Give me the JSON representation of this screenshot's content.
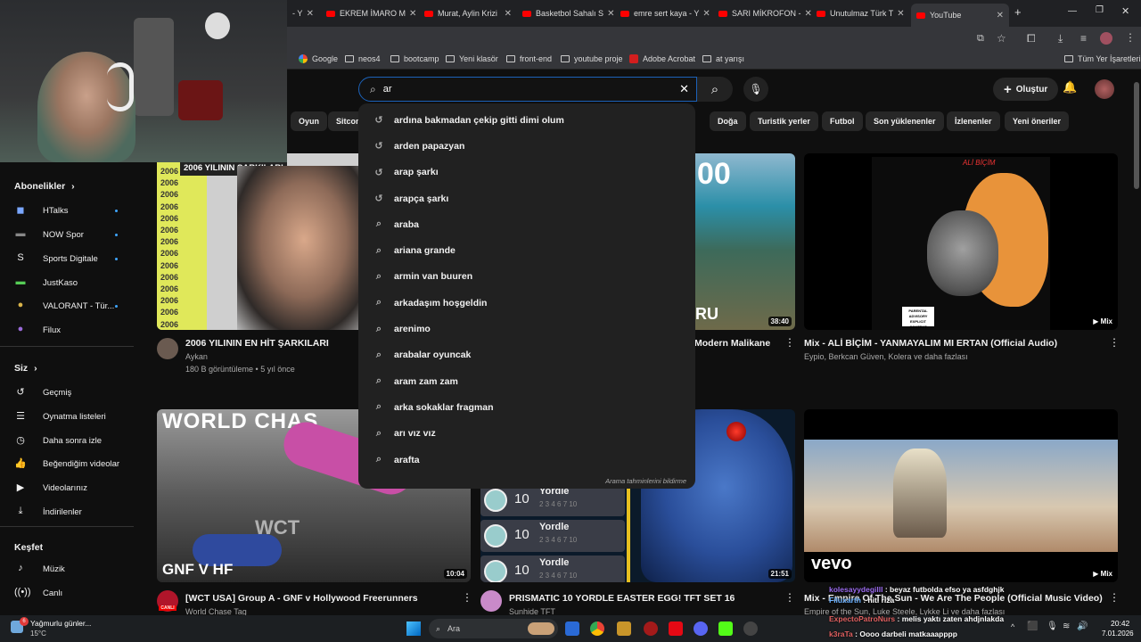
{
  "browser": {
    "tabs": [
      {
        "label": "- Y"
      },
      {
        "label": "EKREM İMARO M"
      },
      {
        "label": "Murat, Aylin Krizi"
      },
      {
        "label": "Basketbol Sahalı S"
      },
      {
        "label": "emre sert kaya - Y"
      },
      {
        "label": "SARI MİKROFON -"
      },
      {
        "label": "Unutulmaz Türk T"
      },
      {
        "label": "YouTube"
      }
    ],
    "bookmarks": [
      "Google",
      "neos4",
      "bootcamp",
      "Yeni klasör",
      "front-end",
      "youtube proje",
      "Adobe Acrobat",
      "at yarışı"
    ],
    "all_bookmarks": "Tüm Yer İşaretleri"
  },
  "search": {
    "value": "ar",
    "suggestions": [
      {
        "text": "ardına bakmadan çekip gitti dimi olum",
        "icon": "history-icon"
      },
      {
        "text": "arden papazyan",
        "icon": "history-icon"
      },
      {
        "text": "arap şarkı",
        "icon": "history-icon"
      },
      {
        "text": "arapça şarkı",
        "icon": "history-icon"
      },
      {
        "text": "araba",
        "icon": "search-icon"
      },
      {
        "text": "ariana grande",
        "icon": "search-icon"
      },
      {
        "text": "armin van buuren",
        "icon": "search-icon"
      },
      {
        "text": "arkadaşım hoşgeldin",
        "icon": "search-icon"
      },
      {
        "text": "arenimo",
        "icon": "search-icon"
      },
      {
        "text": "arabalar oyuncak",
        "icon": "search-icon"
      },
      {
        "text": "aram zam zam",
        "icon": "search-icon"
      },
      {
        "text": "arka sokaklar fragman",
        "icon": "search-icon"
      },
      {
        "text": "arı vız vız",
        "icon": "search-icon"
      },
      {
        "text": "arafta",
        "icon": "search-icon"
      }
    ],
    "report": "Arama tahminlerini bildirme"
  },
  "header": {
    "create_label": "Oluştur"
  },
  "chips": [
    "Oyun",
    "Sitcom",
    "Doğa",
    "Turistik yerler",
    "Futbol",
    "Son yüklenenler",
    "İzlenenler",
    "Yeni öneriler"
  ],
  "sidebar": {
    "subs_title": "Abonelikler",
    "subs": [
      "HTalks",
      "NOW Spor",
      "Sports Digitale",
      "JustKaso",
      "VALORANT - Tür...",
      "Filux"
    ],
    "you_title": "Siz",
    "you_items": [
      "Geçmiş",
      "Oynatma listeleri",
      "Daha sonra izle",
      "Beğendiğim videolar",
      "Videolarınız",
      "İndirilenler"
    ],
    "explore_title": "Keşfet",
    "explore_items": [
      "Müzik",
      "Canlı"
    ]
  },
  "videos": [
    {
      "title": "2006 YILININ EN HİT ŞARKILARI",
      "channel": "Aykan",
      "meta": "180 B görüntüleme • 5 yıl önce",
      "thumb_text": "2006 YILININ ŞARKILARI",
      "year": "2006"
    },
    {
      "title": "Modern Malikane",
      "thumb_text": "00",
      "thumb_text2": "RU",
      "duration": "38:40"
    },
    {
      "title": "Mix - ALİ BİÇİM - YANMAYALIM MI ERTAN (Official Audio)",
      "channel": "Eypio, Berkcan Güven, Kolera ve daha fazlası",
      "badge": "Mix",
      "thumb_text": "ALİ BİÇİM",
      "thumb_text2": "PARENTAL ADVISORY EXPLICIT CONTENT"
    },
    {
      "title": "[WCT USA] Group A - GNF v Hollywood Freerunners",
      "channel": "World Chase Tag",
      "duration": "10:04",
      "thumb_text": "WORLD CHAS",
      "thumb_text2": "GNF V HF",
      "thumb_text3": "WCT",
      "live": "CANLI"
    },
    {
      "title": "PRISMATIC 10 YORDLE EASTER EGG! TFT SET 16",
      "channel": "Sunhide TFT",
      "duration": "21:51",
      "yordle": "Yordle",
      "num": "10",
      "row": "2 3 4 6 7 10"
    },
    {
      "title": "Mix - Empire Of The Sun - We Are The People (Official Music Video)",
      "channel": "Empire of the Sun, Luke Steele, Lykke Li ve daha fazlası",
      "badge": "Mix",
      "thumb_text": "vevo"
    }
  ],
  "overlay": {
    "chat": [
      {
        "user": "kolesayydegilll",
        "msg": "beyaz futbolda efso ya asfdghjk"
      },
      {
        "user": "Filuxarth",
        "msg": "hiti riza"
      },
      {
        "user": "ExpectoPatroNurs",
        "msg": "melis yaktı zaten ahdjnlakda"
      },
      {
        "user": "k3raTa",
        "msg": "Oooo darbeli matkaaapppp"
      }
    ]
  },
  "taskbar": {
    "weather_title": "Yağmurlu günler...",
    "weather_temp": "15°C",
    "weather_badge": "6",
    "search": "Ara",
    "time": "20:42",
    "date": "7.01.2026"
  }
}
